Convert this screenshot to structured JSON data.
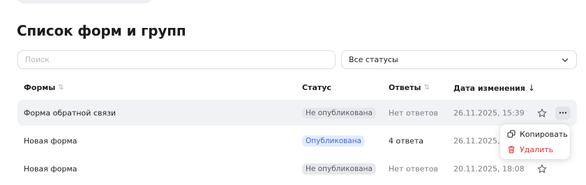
{
  "page": {
    "title": "Список форм и групп"
  },
  "filters": {
    "search_placeholder": "Поиск",
    "status_select_value": "Все статусы"
  },
  "table": {
    "headers": {
      "forms": "Формы",
      "status": "Статус",
      "answers": "Ответы",
      "date": "Дата изменения"
    },
    "sort_icon": "⇅",
    "sort_active_icon": "↓",
    "rows": [
      {
        "name": "Форма обратной связи",
        "status": "Не опубликована",
        "answers": "Нет ответов",
        "date": "26.11.2025, 15:39"
      },
      {
        "name": "Новая форма",
        "status": "Опубликована",
        "answers": "4 ответа",
        "date": "26.11.2025, 15:"
      },
      {
        "name": "Новая форма",
        "status": "Не опубликована",
        "answers": "Нет ответов",
        "date": "20.11.2025, 18:08"
      }
    ]
  },
  "context_menu": {
    "copy_label": "Копировать",
    "delete_label": "Удалить"
  },
  "icons": {
    "sort": "sort-arrows-icon",
    "sort_active": "arrow-down-icon",
    "select": "chevron-down-icon",
    "favorite": "star-icon",
    "more": "more-horizontal-icon",
    "copy": "copy-icon",
    "delete": "trash-icon"
  },
  "colors": {
    "published_bg": "#e3ebff",
    "published_text": "#3e6ad6",
    "unpublished_bg": "#e7e8eb",
    "unpublished_text": "#5b5e66",
    "danger": "#e5322d",
    "row_hover": "#f1f2f5"
  }
}
